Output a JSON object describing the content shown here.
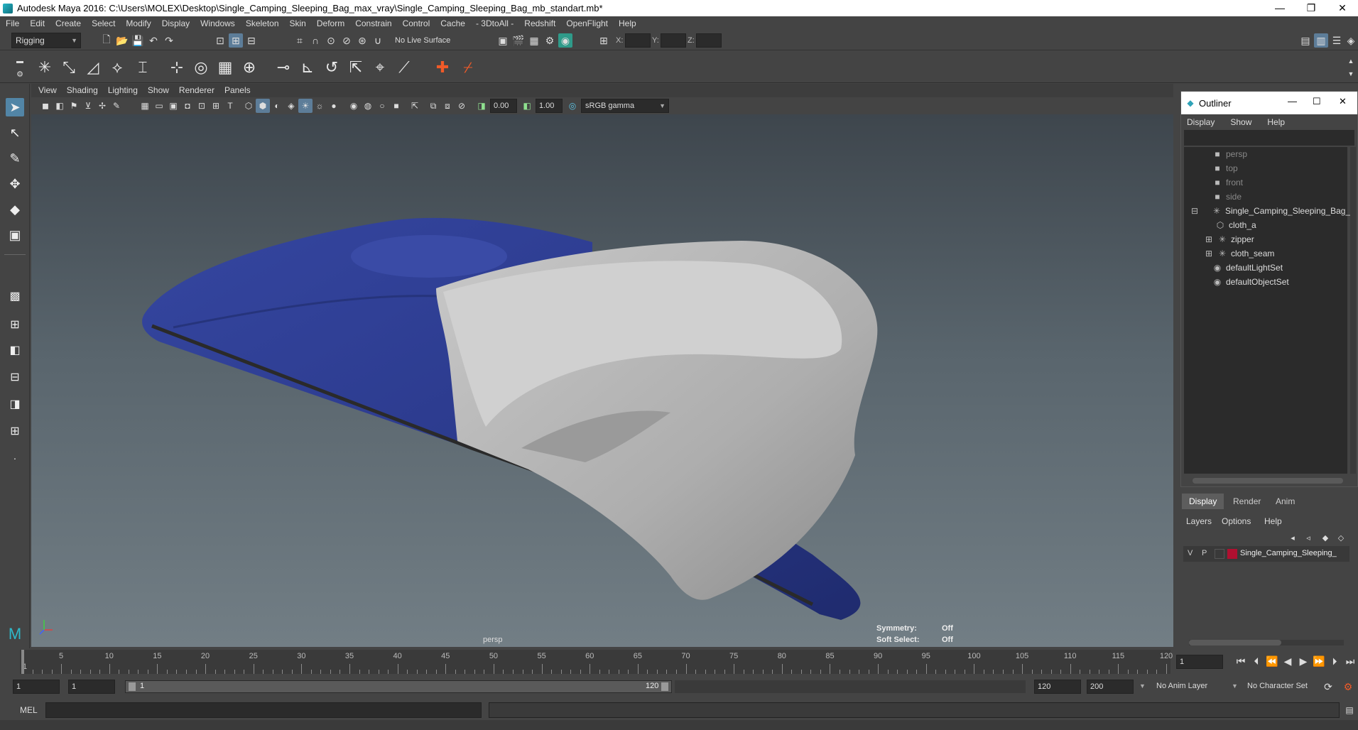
{
  "window": {
    "title": "Autodesk Maya 2016: C:\\Users\\MOLEX\\Desktop\\Single_Camping_Sleeping_Bag_max_vray\\Single_Camping_Sleeping_Bag_mb_standart.mb*",
    "minimize": "—",
    "restore": "❐",
    "close": "✕"
  },
  "menubar": [
    "File",
    "Edit",
    "Create",
    "Select",
    "Modify",
    "Display",
    "Windows",
    "Skeleton",
    "Skin",
    "Deform",
    "Constrain",
    "Control",
    "Cache",
    "- 3DtoAll -",
    "Redshift",
    "OpenFlight",
    "Help"
  ],
  "statusline": {
    "menuset": "Rigging",
    "live_surface": "No Live Surface",
    "x_label": "X:",
    "y_label": "Y:",
    "z_label": "Z:"
  },
  "viewport": {
    "menus": [
      "View",
      "Shading",
      "Lighting",
      "Show",
      "Renderer",
      "Panels"
    ],
    "exposure": "0.00",
    "gamma": "1.00",
    "color_space": "sRGB gamma",
    "camera_label": "persp",
    "symmetry_label": "Symmetry:",
    "symmetry_value": "Off",
    "soft_select_label": "Soft Select:",
    "soft_select_value": "Off"
  },
  "outliner": {
    "title": "Outliner",
    "menus": [
      "Display",
      "Show",
      "Help"
    ],
    "items": [
      {
        "label": "persp",
        "icon": "camera-icon",
        "dim": true
      },
      {
        "label": "top",
        "icon": "camera-icon",
        "dim": true
      },
      {
        "label": "front",
        "icon": "camera-icon",
        "dim": true
      },
      {
        "label": "side",
        "icon": "camera-icon",
        "dim": true
      },
      {
        "label": "Single_Camping_Sleeping_Bag_r",
        "icon": "group-icon",
        "dim": false
      },
      {
        "label": "cloth_a",
        "icon": "mesh-icon",
        "dim": false
      },
      {
        "label": "zipper",
        "icon": "group-icon",
        "dim": false
      },
      {
        "label": "cloth_seam",
        "icon": "group-icon",
        "dim": false
      },
      {
        "label": "defaultLightSet",
        "icon": "set-icon",
        "dim": false
      },
      {
        "label": "defaultObjectSet",
        "icon": "set-icon",
        "dim": false
      }
    ]
  },
  "layer_editor": {
    "tabs": [
      "Display",
      "Render",
      "Anim"
    ],
    "menus": [
      "Layers",
      "Options",
      "Help"
    ],
    "layer": {
      "v": "V",
      "p": "P",
      "name": "Single_Camping_Sleeping_",
      "color": "#b01030"
    }
  },
  "timeslider": {
    "start": 1,
    "end": 120,
    "labels": [
      "5",
      "10",
      "15",
      "20",
      "25",
      "30",
      "35",
      "40",
      "45",
      "50",
      "55",
      "60",
      "65",
      "70",
      "75",
      "80",
      "85",
      "90",
      "95",
      "100",
      "105",
      "110",
      "115",
      "120"
    ],
    "first_label": "1",
    "current_frame": "1"
  },
  "rangeslider": {
    "start_time": "1",
    "playback_start": "1",
    "range_start": "1",
    "range_end": "120",
    "playback_end": "120",
    "end_time": "200",
    "anim_layer": "No Anim Layer",
    "character_set": "No Character Set"
  },
  "cmdline": {
    "label": "MEL"
  },
  "colors": {
    "bag_outer": "#2a3a8c",
    "bag_inner": "#b8b8b8",
    "selection_highlight": "#5285a6",
    "layer_color": "#b01030"
  }
}
